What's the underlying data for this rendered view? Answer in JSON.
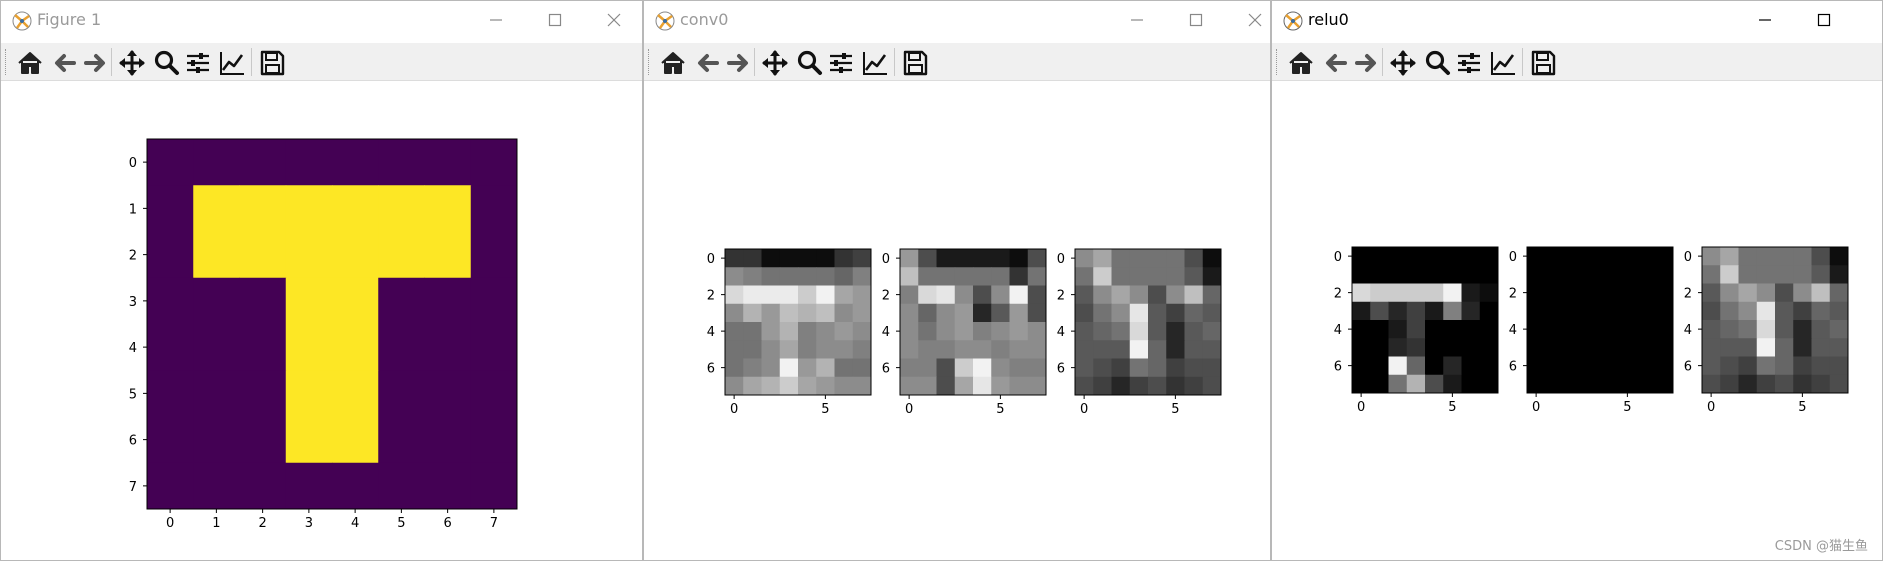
{
  "windows": [
    {
      "title": "Figure 1",
      "active": false
    },
    {
      "title": "conv0",
      "active": false
    },
    {
      "title": "relu0",
      "active": true
    }
  ],
  "toolbar_buttons": [
    "home-icon",
    "back-icon",
    "forward-icon",
    "pan-icon",
    "zoom-icon",
    "configure-subplots-icon",
    "edit-axis-icon",
    "save-icon"
  ],
  "colors": {
    "viridis_low": "#440154",
    "viridis_high": "#fde725"
  },
  "watermark": "CSDN @猫生鱼",
  "chart_data": [
    {
      "type": "heatmap",
      "title": "",
      "colormap": "viridis",
      "x_ticks": [
        "0",
        "1",
        "2",
        "3",
        "4",
        "5",
        "6",
        "7"
      ],
      "y_ticks": [
        "0",
        "1",
        "2",
        "3",
        "4",
        "5",
        "6",
        "7"
      ],
      "values": [
        [
          0,
          0,
          0,
          0,
          0,
          0,
          0,
          0
        ],
        [
          0,
          1,
          1,
          1,
          1,
          1,
          1,
          0
        ],
        [
          0,
          1,
          1,
          1,
          1,
          1,
          1,
          0
        ],
        [
          0,
          0,
          0,
          1,
          1,
          0,
          0,
          0
        ],
        [
          0,
          0,
          0,
          1,
          1,
          0,
          0,
          0
        ],
        [
          0,
          0,
          0,
          1,
          1,
          0,
          0,
          0
        ],
        [
          0,
          0,
          0,
          1,
          1,
          0,
          0,
          0
        ],
        [
          0,
          0,
          0,
          0,
          0,
          0,
          0,
          0
        ]
      ]
    },
    {
      "type": "heatmap",
      "colormap": "gray",
      "x_ticks": [
        "0",
        "5"
      ],
      "y_ticks": [
        "0",
        "2",
        "4",
        "6"
      ],
      "panels": [
        {
          "values": [
            [
              0.2,
              0.2,
              0.05,
              0.05,
              0.05,
              0.05,
              0.2,
              0.25
            ],
            [
              0.55,
              0.5,
              0.45,
              0.45,
              0.45,
              0.45,
              0.4,
              0.5
            ],
            [
              0.85,
              0.92,
              0.92,
              0.92,
              0.8,
              0.95,
              0.65,
              0.6
            ],
            [
              0.55,
              0.7,
              0.6,
              0.75,
              0.7,
              0.75,
              0.55,
              0.6
            ],
            [
              0.45,
              0.45,
              0.6,
              0.7,
              0.5,
              0.55,
              0.6,
              0.55
            ],
            [
              0.45,
              0.45,
              0.55,
              0.65,
              0.5,
              0.55,
              0.55,
              0.5
            ],
            [
              0.45,
              0.5,
              0.55,
              0.95,
              0.6,
              0.7,
              0.45,
              0.45
            ],
            [
              0.55,
              0.65,
              0.7,
              0.8,
              0.65,
              0.6,
              0.55,
              0.55
            ]
          ]
        },
        {
          "values": [
            [
              0.6,
              0.3,
              0.1,
              0.1,
              0.1,
              0.1,
              0.05,
              0.3
            ],
            [
              0.75,
              0.45,
              0.45,
              0.45,
              0.45,
              0.45,
              0.2,
              0.45
            ],
            [
              0.5,
              0.85,
              0.9,
              0.55,
              0.3,
              0.55,
              0.95,
              0.3
            ],
            [
              0.55,
              0.4,
              0.55,
              0.6,
              0.15,
              0.35,
              0.6,
              0.3
            ],
            [
              0.55,
              0.45,
              0.55,
              0.6,
              0.5,
              0.55,
              0.6,
              0.55
            ],
            [
              0.55,
              0.5,
              0.5,
              0.55,
              0.55,
              0.5,
              0.55,
              0.55
            ],
            [
              0.5,
              0.5,
              0.3,
              0.8,
              0.95,
              0.55,
              0.5,
              0.5
            ],
            [
              0.55,
              0.55,
              0.3,
              0.65,
              0.9,
              0.6,
              0.55,
              0.55
            ]
          ]
        },
        {
          "values": [
            [
              0.55,
              0.65,
              0.45,
              0.45,
              0.45,
              0.45,
              0.3,
              0.05
            ],
            [
              0.45,
              0.8,
              0.45,
              0.45,
              0.45,
              0.45,
              0.35,
              0.1
            ],
            [
              0.35,
              0.55,
              0.65,
              0.55,
              0.3,
              0.55,
              0.75,
              0.4
            ],
            [
              0.3,
              0.45,
              0.55,
              0.9,
              0.35,
              0.25,
              0.4,
              0.35
            ],
            [
              0.35,
              0.4,
              0.45,
              0.85,
              0.35,
              0.15,
              0.35,
              0.4
            ],
            [
              0.35,
              0.35,
              0.35,
              0.95,
              0.4,
              0.15,
              0.35,
              0.35
            ],
            [
              0.35,
              0.3,
              0.25,
              0.45,
              0.4,
              0.25,
              0.3,
              0.3
            ],
            [
              0.3,
              0.25,
              0.15,
              0.25,
              0.3,
              0.2,
              0.25,
              0.3
            ]
          ]
        }
      ]
    },
    {
      "type": "heatmap",
      "colormap": "gray",
      "x_ticks": [
        "0",
        "5"
      ],
      "y_ticks": [
        "0",
        "2",
        "4",
        "6"
      ],
      "panels": [
        {
          "values": [
            [
              0,
              0,
              0,
              0,
              0,
              0,
              0,
              0
            ],
            [
              0,
              0,
              0,
              0,
              0,
              0,
              0,
              0
            ],
            [
              0.85,
              0.8,
              0.8,
              0.8,
              0.8,
              0.95,
              0.1,
              0.05
            ],
            [
              0.1,
              0.3,
              0.15,
              0.25,
              0.1,
              0.5,
              0.15,
              0
            ],
            [
              0,
              0,
              0.1,
              0.25,
              0,
              0,
              0,
              0
            ],
            [
              0,
              0,
              0.15,
              0.2,
              0,
              0,
              0,
              0
            ],
            [
              0,
              0,
              0.95,
              0.4,
              0,
              0.15,
              0,
              0
            ],
            [
              0,
              0,
              0.45,
              0.7,
              0.3,
              0.1,
              0,
              0
            ]
          ]
        },
        {
          "values": [
            [
              0,
              0,
              0,
              0,
              0,
              0,
              0,
              0
            ],
            [
              0,
              0,
              0,
              0,
              0,
              0,
              0,
              0
            ],
            [
              0,
              0,
              0,
              0,
              0,
              0,
              0,
              0
            ],
            [
              0,
              0,
              0,
              0,
              0,
              0,
              0,
              0
            ],
            [
              0,
              0,
              0,
              0,
              0,
              0,
              0,
              0
            ],
            [
              0,
              0,
              0,
              0,
              0,
              0,
              0,
              0
            ],
            [
              0,
              0,
              0,
              0,
              0,
              0,
              0,
              0
            ],
            [
              0,
              0,
              0,
              0,
              0,
              0,
              0,
              0
            ]
          ]
        },
        {
          "values": [
            [
              0.55,
              0.65,
              0.45,
              0.45,
              0.45,
              0.45,
              0.3,
              0.05
            ],
            [
              0.45,
              0.8,
              0.45,
              0.45,
              0.45,
              0.45,
              0.35,
              0.1
            ],
            [
              0.35,
              0.55,
              0.65,
              0.55,
              0.3,
              0.55,
              0.75,
              0.4
            ],
            [
              0.3,
              0.45,
              0.55,
              0.9,
              0.35,
              0.25,
              0.4,
              0.35
            ],
            [
              0.35,
              0.4,
              0.45,
              0.85,
              0.35,
              0.15,
              0.35,
              0.4
            ],
            [
              0.35,
              0.35,
              0.35,
              0.95,
              0.4,
              0.15,
              0.35,
              0.35
            ],
            [
              0.35,
              0.3,
              0.25,
              0.45,
              0.4,
              0.25,
              0.3,
              0.3
            ],
            [
              0.3,
              0.25,
              0.15,
              0.25,
              0.3,
              0.2,
              0.25,
              0.3
            ]
          ]
        }
      ]
    }
  ]
}
